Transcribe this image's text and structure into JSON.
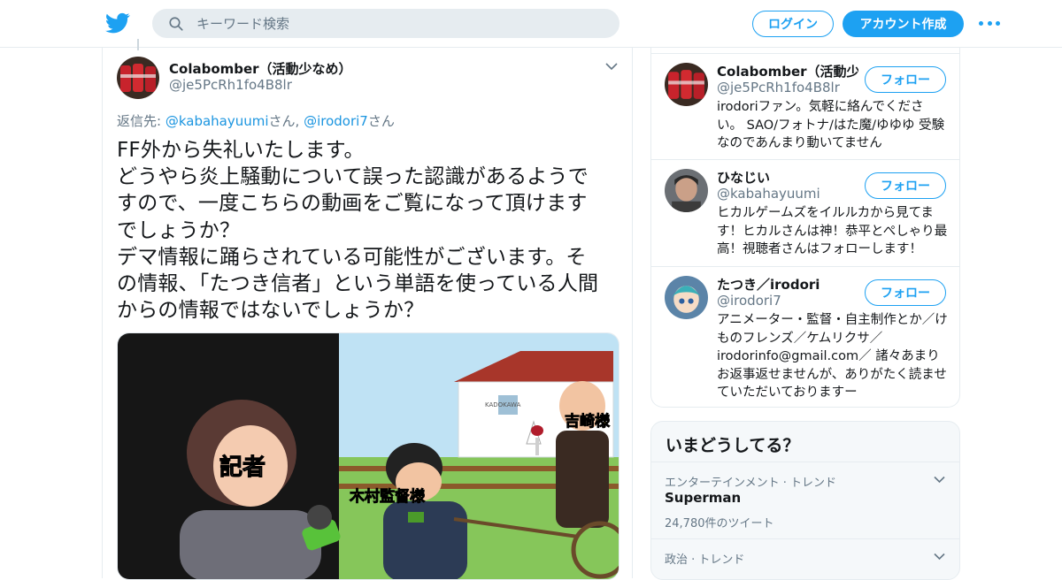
{
  "search": {
    "placeholder": "キーワード検索"
  },
  "header": {
    "login_label": "ログイン",
    "signup_label": "アカウント作成"
  },
  "tweet": {
    "author_name": "Colabomber（活動少なめ）",
    "author_handle": "@je5PcRh1fo4B8lr",
    "reply_prefix": "返信先: ",
    "reply_user1": "@kabahayuumi",
    "reply_san1": "さん, ",
    "reply_user2": "@irodori7",
    "reply_san2": "さん",
    "text": "FF外から失礼いたします。\nどうやら炎上騒動について誤った認識があるようで\nすので、一度こちらの動画をご覧になって頂けます\nでしょうか？\nデマ情報に踊らされている可能性がございます。そ\nの情報、「たつき信者」という単語を使っている人間\nからの情報ではないでしょうか？",
    "media": {
      "label_reporter": "記者",
      "label_director": "木村監督様",
      "label_yoshizaki": "吉崎様",
      "label_building": "KADOKAWA"
    }
  },
  "who_to_follow": {
    "follow_label": "フォロー",
    "users": [
      {
        "name": "Colabomber（活動少…",
        "handle": "@je5PcRh1fo4B8lr",
        "bio": "irodoriファン。気軽に絡んでください。 SAO/フォトナ/はた魔/ゆゆゆ 受験なのであんまり動いてません"
      },
      {
        "name": "ひなじい",
        "handle": "@kabahayuumi",
        "bio": "ヒカルゲームズをイルルカから見てます！ヒカルさんは神！恭平とぺしゃり最高！視聴者さんはフォローします！"
      },
      {
        "name": "たつき／irodori",
        "handle": "@irodori7",
        "bio": "アニメーター・監督・自主制作とか／けものフレンズ／ケムリクサ／irodorinfo@gmail.com／ 諸々あまりお返事返せませんが、ありがたく読ませていただいておりますー"
      }
    ]
  },
  "trends": {
    "title": "いまどうしてる？",
    "items": [
      {
        "category": "エンターテインメント · トレンド",
        "name": "Superman",
        "count": "24,780件のツイート"
      },
      {
        "category": "政治 · トレンド",
        "name": "",
        "count": ""
      }
    ]
  },
  "colors": {
    "accent": "#1da1f2",
    "link": "#1b95e0",
    "secondary_text": "#657786",
    "border": "#e6ecf0"
  },
  "icons": [
    "twitter-bird-logo",
    "search-icon",
    "more-dots-icon",
    "chevron-down-icon"
  ]
}
